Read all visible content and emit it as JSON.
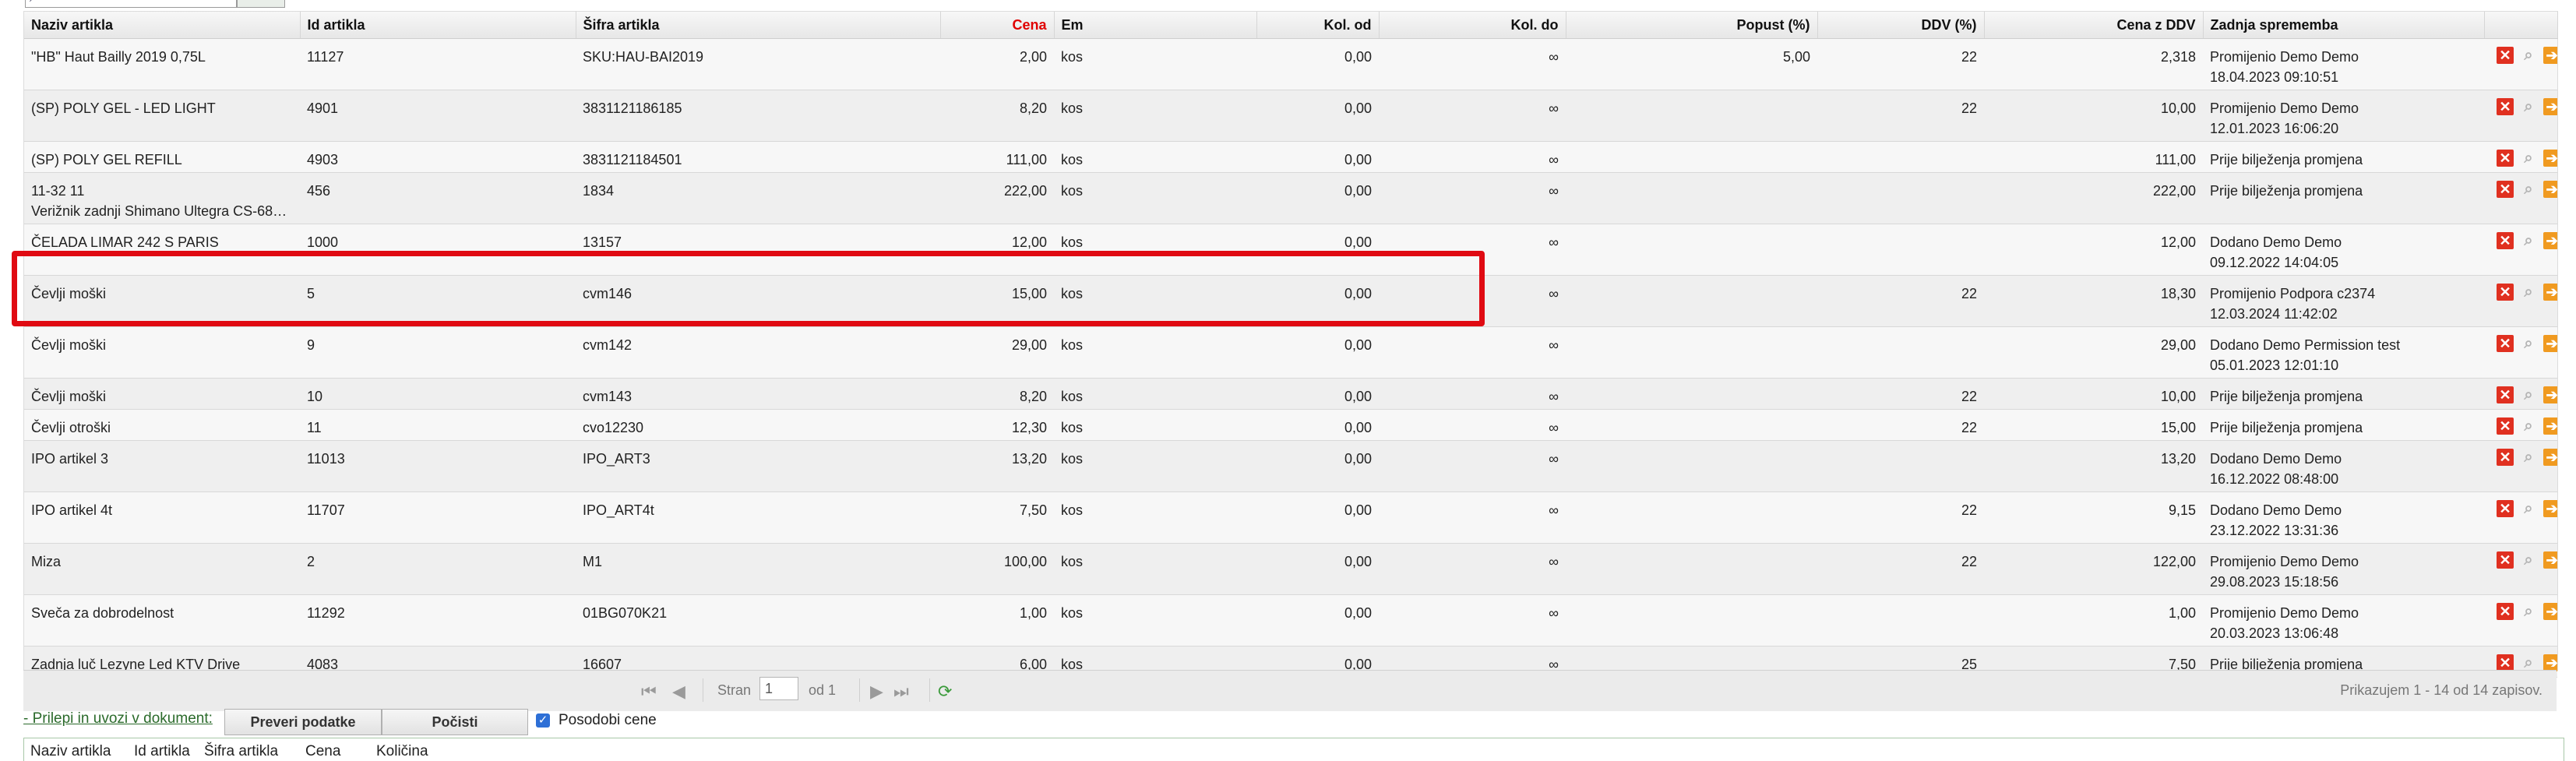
{
  "columns": [
    "Naziv artikla",
    "Id artikla",
    "Šifra artikla",
    "Cena",
    "Em",
    "Kol. od",
    "Kol. do",
    "Popust (%)",
    "DDV (%)",
    "Cena z DDV",
    "Zadnja sprememba"
  ],
  "rows": [
    {
      "name_lines": [
        "\"HB\" Haut Bailly 2019 0,75L"
      ],
      "id": "11127",
      "sku": "SKU:HAU-BAI2019",
      "price": "2,00",
      "unit": "kos",
      "qty_from": "0,00",
      "qty_to": "∞",
      "discount": "5,00",
      "vat": "22",
      "price_vat": "2,318",
      "change_lines": [
        "Promijenio Demo Demo",
        "18.04.2023 09:10:51"
      ]
    },
    {
      "name_lines": [
        "(SP) POLY GEL - LED LIGHT"
      ],
      "id": "4901",
      "sku": "3831121186185",
      "price": "8,20",
      "unit": "kos",
      "qty_from": "0,00",
      "qty_to": "∞",
      "discount": "",
      "vat": "22",
      "price_vat": "10,00",
      "change_lines": [
        "Promijenio Demo Demo",
        "12.01.2023 16:06:20"
      ]
    },
    {
      "name_lines": [
        "(SP) POLY GEL REFILL"
      ],
      "id": "4903",
      "sku": "3831121184501",
      "price": "111,00",
      "unit": "kos",
      "qty_from": "0,00",
      "qty_to": "∞",
      "discount": "",
      "vat": "",
      "price_vat": "111,00",
      "change_lines": [
        "Prije bilježenja promjena"
      ]
    },
    {
      "name_lines": [
        "11-32 11",
        "Verižnik zadnji Shimano Ultegra CS-68…"
      ],
      "id": "456",
      "sku": "1834",
      "price": "222,00",
      "unit": "kos",
      "qty_from": "0,00",
      "qty_to": "∞",
      "discount": "",
      "vat": "",
      "price_vat": "222,00",
      "change_lines": [
        "Prije bilježenja promjena"
      ]
    },
    {
      "name_lines": [
        "ČELADA LIMAR 242 S PARIS"
      ],
      "id": "1000",
      "sku": "13157",
      "price": "12,00",
      "unit": "kos",
      "qty_from": "0,00",
      "qty_to": "∞",
      "discount": "",
      "vat": "",
      "price_vat": "12,00",
      "change_lines": [
        "Dodano Demo Demo",
        "09.12.2022 14:04:05"
      ]
    },
    {
      "name_lines": [
        "Čevlji moški"
      ],
      "id": "5",
      "sku": "cvm146",
      "price": "15,00",
      "unit": "kos",
      "qty_from": "0,00",
      "qty_to": "∞",
      "discount": "",
      "vat": "22",
      "price_vat": "18,30",
      "change_lines": [
        "Promijenio Podpora c2374",
        "12.03.2024 11:42:02"
      ]
    },
    {
      "name_lines": [
        "Čevlji moški"
      ],
      "id": "9",
      "sku": "cvm142",
      "price": "29,00",
      "unit": "kos",
      "qty_from": "0,00",
      "qty_to": "∞",
      "discount": "",
      "vat": "",
      "price_vat": "29,00",
      "change_lines": [
        "Dodano Demo Permission test",
        "05.01.2023 12:01:10"
      ]
    },
    {
      "name_lines": [
        "Čevlji moški"
      ],
      "id": "10",
      "sku": "cvm143",
      "price": "8,20",
      "unit": "kos",
      "qty_from": "0,00",
      "qty_to": "∞",
      "discount": "",
      "vat": "22",
      "price_vat": "10,00",
      "change_lines": [
        "Prije bilježenja promjena"
      ]
    },
    {
      "name_lines": [
        "Čevlji otroški"
      ],
      "id": "11",
      "sku": "cvo12230",
      "price": "12,30",
      "unit": "kos",
      "qty_from": "0,00",
      "qty_to": "∞",
      "discount": "",
      "vat": "22",
      "price_vat": "15,00",
      "change_lines": [
        "Prije bilježenja promjena"
      ]
    },
    {
      "name_lines": [
        "IPO artikel 3"
      ],
      "id": "11013",
      "sku": "IPO_ART3",
      "price": "13,20",
      "unit": "kos",
      "qty_from": "0,00",
      "qty_to": "∞",
      "discount": "",
      "vat": "",
      "price_vat": "13,20",
      "change_lines": [
        "Dodano Demo Demo",
        "16.12.2022 08:48:00"
      ]
    },
    {
      "name_lines": [
        "IPO artikel 4t"
      ],
      "id": "11707",
      "sku": "IPO_ART4t",
      "price": "7,50",
      "unit": "kos",
      "qty_from": "0,00",
      "qty_to": "∞",
      "discount": "",
      "vat": "22",
      "price_vat": "9,15",
      "change_lines": [
        "Dodano Demo Demo",
        "23.12.2022 13:31:36"
      ]
    },
    {
      "name_lines": [
        "Miza"
      ],
      "id": "2",
      "sku": "M1",
      "price": "100,00",
      "unit": "kos",
      "qty_from": "0,00",
      "qty_to": "∞",
      "discount": "",
      "vat": "22",
      "price_vat": "122,00",
      "change_lines": [
        "Promijenio Demo Demo",
        "29.08.2023 15:18:56"
      ]
    },
    {
      "name_lines": [
        "Sveča za dobrodelnost"
      ],
      "id": "11292",
      "sku": "01BG070K21",
      "price": "1,00",
      "unit": "kos",
      "qty_from": "0,00",
      "qty_to": "∞",
      "discount": "",
      "vat": "",
      "price_vat": "1,00",
      "change_lines": [
        "Promijenio Demo Demo",
        "20.03.2023 13:06:48"
      ]
    },
    {
      "name_lines": [
        "Zadnja luč Lezyne Led KTV Drive"
      ],
      "id": "4083",
      "sku": "16607",
      "price": "6,00",
      "unit": "kos",
      "qty_from": "0,00",
      "qty_to": "∞",
      "discount": "",
      "vat": "25",
      "price_vat": "7,50",
      "change_lines": [
        "Prije bilježenja promjena"
      ]
    }
  ],
  "pager": {
    "page_label": "Stran",
    "page_value": "1",
    "of_label": "od 1",
    "info": "Prikazujem 1 - 14 od 14 zapisov."
  },
  "bottom": {
    "paste_link": "- Prilepi in uvozi v dokument:",
    "check_button": "Preveri podatke",
    "clear_button": "Počisti",
    "update_prices_label": "Posodobi cene",
    "update_prices_checked": true,
    "paste_columns": [
      "Naziv artikla",
      "Id artikla",
      "Šifra artikla",
      "Cena",
      "Količina"
    ]
  },
  "colors": {
    "highlight": "#e00a12",
    "price_header": "#e00000",
    "link": "#2a6a2a"
  }
}
